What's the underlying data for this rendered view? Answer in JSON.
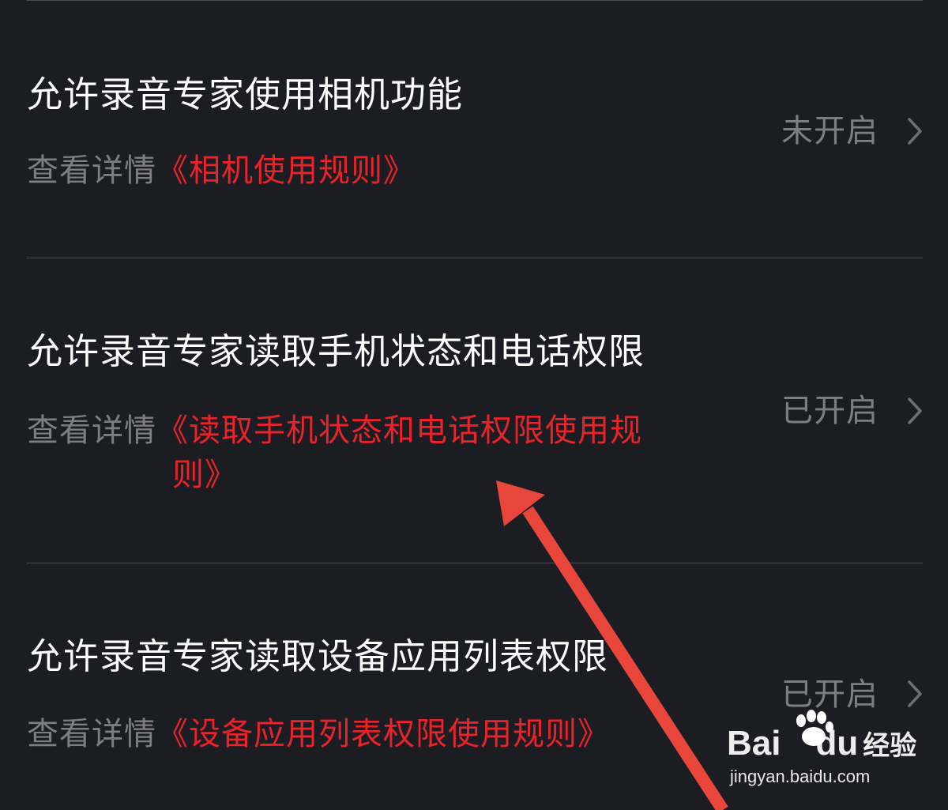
{
  "permissions": [
    {
      "title": "允许录音专家使用相机功能",
      "detail_prefix": "查看详情",
      "detail_link": "《相机使用规则》",
      "status": "未开启"
    },
    {
      "title": "允许录音专家读取手机状态和电话权限",
      "detail_prefix": "查看详情",
      "detail_link_line1": "《读取手机状态和电话权限使用规",
      "detail_link_line2": "则》",
      "status": "已开启"
    },
    {
      "title": "允许录音专家读取设备应用列表权限",
      "detail_prefix": "查看详情",
      "detail_link": "《设备应用列表权限使用规则》",
      "status": "已开启"
    }
  ],
  "watermark": {
    "logo_text": "Bai",
    "logo_text2": "du",
    "logo_cn": "经验",
    "url": "jingyan.baidu.com"
  },
  "colors": {
    "background": "#1c1d23",
    "title": "#ffffff",
    "secondary": "#7d7e84",
    "link": "#e8232a",
    "annotation_arrow": "#e8463a"
  }
}
